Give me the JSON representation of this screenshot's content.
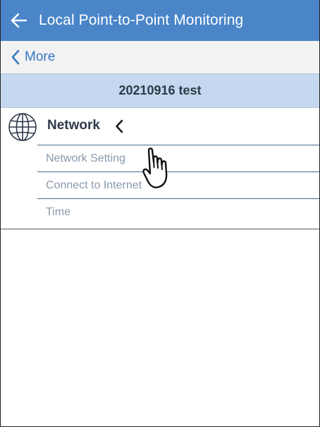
{
  "header": {
    "title": "Local Point-to-Point Monitoring",
    "back_icon": "arrow-left-icon"
  },
  "nav": {
    "back_label": "More",
    "back_icon": "chevron-left-icon"
  },
  "device": {
    "name": "20210916 test"
  },
  "section": {
    "icon": "globe-icon",
    "title": "Network",
    "collapse_icon": "chevron-left-icon",
    "items": [
      {
        "label": "Network Setting"
      },
      {
        "label": "Connect to Internet"
      },
      {
        "label": "Time"
      }
    ]
  },
  "overlay": {
    "cursor_icon": "hand-pointer-icon"
  },
  "colors": {
    "header_bg": "#4a85c8",
    "link": "#3a78c2",
    "device_bar_bg": "#c4d9ef",
    "subitem_text": "#8a9aac"
  }
}
